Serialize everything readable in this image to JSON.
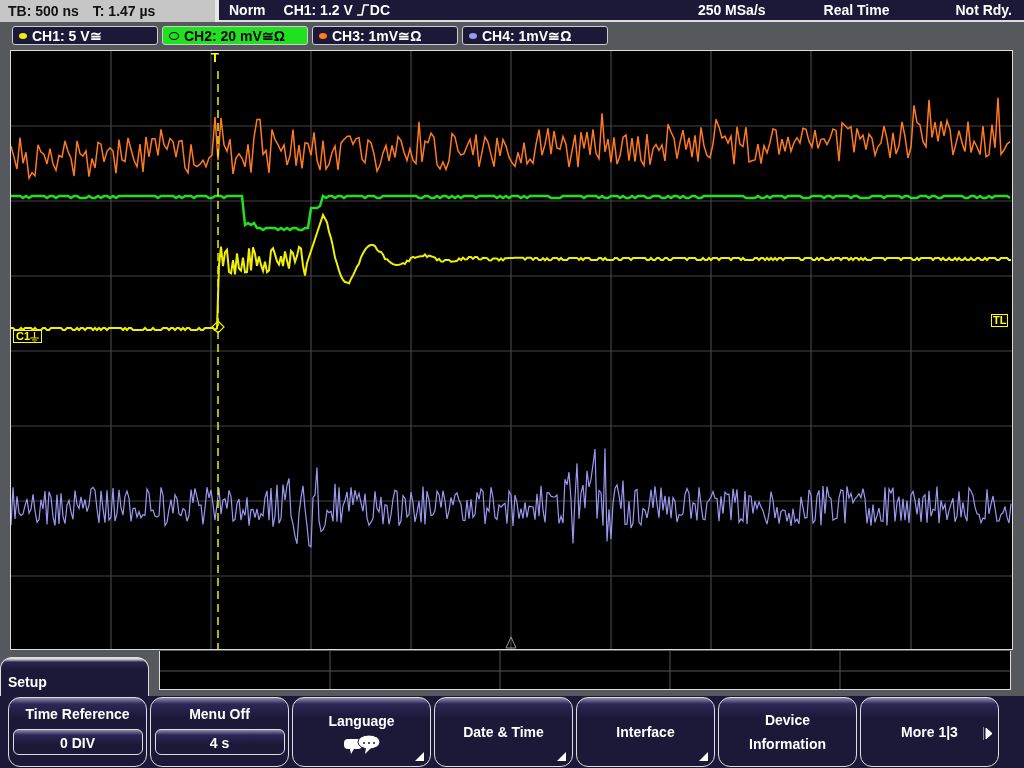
{
  "status": {
    "timebase": "TB: 500 ns",
    "trigger_time": "T: 1.47 µs",
    "trigger_mode": "Norm",
    "trigger_source": "CH1: 1.2 V",
    "coupling": "DC",
    "sample_rate": "250 MSa/s",
    "acquisition": "Real Time",
    "state": "Not Rdy."
  },
  "channels": [
    {
      "label": "CH1: 5 V≅",
      "color": "#f0f000",
      "selected": false
    },
    {
      "label": "CH2: 20 mV≅Ω",
      "color": "#20e020",
      "selected": true
    },
    {
      "label": "CH3: 1mV≅Ω",
      "color": "#ff7a20",
      "selected": false
    },
    {
      "label": "CH4: 1mV≅Ω",
      "color": "#9a98f0",
      "selected": false
    }
  ],
  "markers": {
    "trigger": "T",
    "channel_label": "C1",
    "trigger_level": "TL"
  },
  "menu": {
    "title": "Setup",
    "softkeys": [
      {
        "kind": "value",
        "label": "Time Reference",
        "value": "0 DIV"
      },
      {
        "kind": "value",
        "label": "Menu Off",
        "value": "4 s"
      },
      {
        "kind": "language",
        "label": "Language"
      },
      {
        "kind": "submenu",
        "label": "Date & Time"
      },
      {
        "kind": "submenu",
        "label": "Interface"
      },
      {
        "kind": "plain",
        "label": "Device Information"
      },
      {
        "kind": "next",
        "label": "More 1|3"
      }
    ]
  }
}
